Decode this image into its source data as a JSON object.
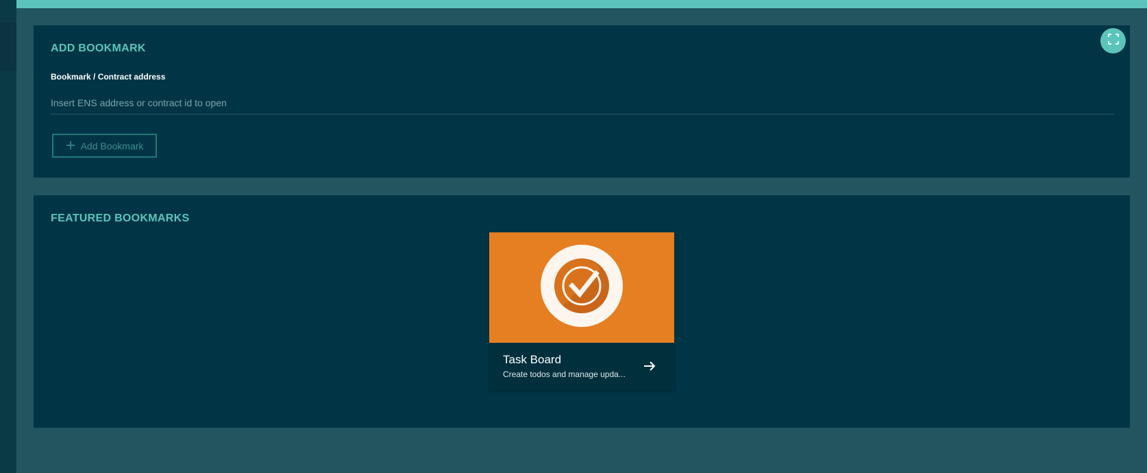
{
  "add_bookmark": {
    "title": "ADD BOOKMARK",
    "field_label": "Bookmark / Contract address",
    "placeholder": "Insert ENS address or contract id to open",
    "value": "",
    "button_label": "Add Bookmark"
  },
  "featured": {
    "title": "FEATURED BOOKMARKS",
    "cards": [
      {
        "title": "Task Board",
        "description": "Create todos and manage upda...",
        "icon": "check-circle-icon",
        "image_color": "#e67e22"
      }
    ]
  },
  "icons": {
    "fullscreen": "fullscreen-icon",
    "plus": "plus-icon",
    "arrow": "arrow-right-icon"
  },
  "colors": {
    "accent": "#5cc4bb",
    "panel_bg": "#013545",
    "page_bg": "#235560",
    "card_image": "#e67e22"
  }
}
